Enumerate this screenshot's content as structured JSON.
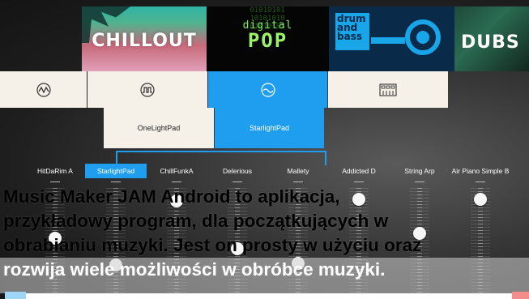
{
  "genres": [
    {
      "name": "CHILLOUT"
    },
    {
      "name_top": "digital",
      "name_main": "POP",
      "bits": "01010101\n10101010\n01010101"
    },
    {
      "name_line1": "drum",
      "name_line2": "and",
      "name_line3": "bass"
    },
    {
      "name": "DUBS"
    }
  ],
  "instrument_tiles": [
    {
      "icon": "wave-zigzag-icon"
    },
    {
      "icon": "wave-square-icon"
    },
    {
      "icon": "pad-wave-icon",
      "selected": true
    },
    {
      "icon": "keyboard-icon"
    }
  ],
  "sound_options": [
    {
      "label": "OneLightPad"
    },
    {
      "label": "StarlightPad",
      "selected": true
    }
  ],
  "tracks": [
    {
      "label": "HitDaRim A",
      "level": 0.55
    },
    {
      "label": "StarlightPad",
      "selected": true,
      "level": 0.28
    },
    {
      "label": "ChillFunkA",
      "level": 0.93
    },
    {
      "label": "Delerious",
      "level": 0.45
    },
    {
      "label": "Mallety",
      "level": 0.3
    },
    {
      "label": "Addicted D",
      "level": 0.95
    },
    {
      "label": "String Arp",
      "level": 0.6
    },
    {
      "label": "Air Piano Simple B",
      "level": 0.95
    }
  ],
  "caption": {
    "line1": "Music Maker JAM Android to aplikacja,",
    "line2": "przykładowy program, dla początkujących w",
    "line3": "obrabianiu muzyki. Jest on prosty w użyciu oraz",
    "line4": "rozwija wiele możliwości w obróbce muzyki."
  },
  "colors": {
    "accent": "#1f9ef0",
    "tile_bg": "#f5f1e8",
    "left_marker": "#9fd6f5",
    "right_marker": "#f28d8a"
  }
}
